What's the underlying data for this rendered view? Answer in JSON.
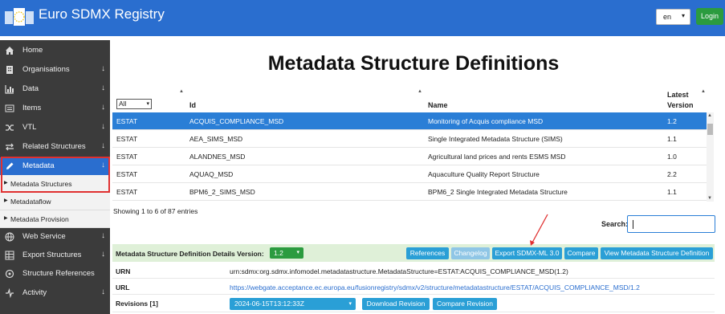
{
  "header": {
    "brand": "Euro SDMX Registry",
    "language": "en",
    "login_label": "Login",
    "colors": {
      "header_bg": "#2a6ecf",
      "login_bg": "#2b9b3f"
    }
  },
  "sidebar": {
    "items": [
      {
        "label": "Home",
        "icon": "home-icon",
        "arrow": ""
      },
      {
        "label": "Organisations",
        "icon": "building-icon",
        "arrow": "↓"
      },
      {
        "label": "Data",
        "icon": "bar-chart-icon",
        "arrow": "↓"
      },
      {
        "label": "Items",
        "icon": "list-icon",
        "arrow": "↓"
      },
      {
        "label": "VTL",
        "icon": "shuffle-icon",
        "arrow": "↓"
      },
      {
        "label": "Related Structures",
        "icon": "swap-icon",
        "arrow": "↓"
      },
      {
        "label": "Metadata",
        "icon": "pencil-icon",
        "arrow": "↓"
      },
      {
        "label": "Web Service",
        "icon": "globe-icon",
        "arrow": "↓"
      },
      {
        "label": "Export Structures",
        "icon": "table-icon",
        "arrow": "↓"
      },
      {
        "label": "Structure References",
        "icon": "target-icon",
        "arrow": ""
      },
      {
        "label": "Activity",
        "icon": "pulse-icon",
        "arrow": "↓"
      }
    ],
    "subitems": [
      {
        "label": "Metadata Structures"
      },
      {
        "label": "Metadataflow"
      },
      {
        "label": "Metadata Provision"
      }
    ]
  },
  "main": {
    "title": "Metadata Structure Definitions",
    "filter_value": "All",
    "columns": {
      "id": "Id",
      "name": "Name",
      "latest_version_1": "Latest",
      "latest_version_2": "Version"
    },
    "rows": [
      {
        "agency": "ESTAT",
        "id": "ACQUIS_COMPLIANCE_MSD",
        "name": "Monitoring of Acquis compliance MSD",
        "version": "1.2"
      },
      {
        "agency": "ESTAT",
        "id": "AEA_SIMS_MSD",
        "name": "Single Integrated Metadata Structure (SIMS)",
        "version": "1.1"
      },
      {
        "agency": "ESTAT",
        "id": "ALANDNES_MSD",
        "name": "Agricultural land prices and rents ESMS MSD",
        "version": "1.0"
      },
      {
        "agency": "ESTAT",
        "id": "AQUAQ_MSD",
        "name": "Aquaculture Quality Report Structure",
        "version": "2.2"
      },
      {
        "agency": "ESTAT",
        "id": "BPM6_2_SIMS_MSD",
        "name": "BPM6_2 Single Integrated Metadata Structure",
        "version": "1.1"
      }
    ],
    "showing": "Showing 1 to 6 of 87 entries",
    "search_label": "Search:",
    "search_value": ""
  },
  "details": {
    "label": "Metadata Structure Definition Details Version:",
    "version": "1.2",
    "buttons": {
      "references": "References",
      "changelog": "Changelog",
      "export": "Export SDMX-ML 3.0",
      "compare": "Compare",
      "view": "View Metadata Structure Definition"
    },
    "urn_key": "URN",
    "urn": "urn:sdmx:org.sdmx.infomodel.metadatastructure.MetadataStructure=ESTAT:ACQUIS_COMPLIANCE_MSD(1.2)",
    "url_key": "URL",
    "url": "https://webgate.acceptance.ec.europa.eu/fusionregistry/sdmx/v2/structure/metadatastructure/ESTAT/ACQUIS_COMPLIANCE_MSD/1.2",
    "revisions_key": "Revisions [1]",
    "revision": "2024-06-15T13:12:33Z",
    "download_revision": "Download Revision",
    "compare_revision": "Compare Revision"
  }
}
